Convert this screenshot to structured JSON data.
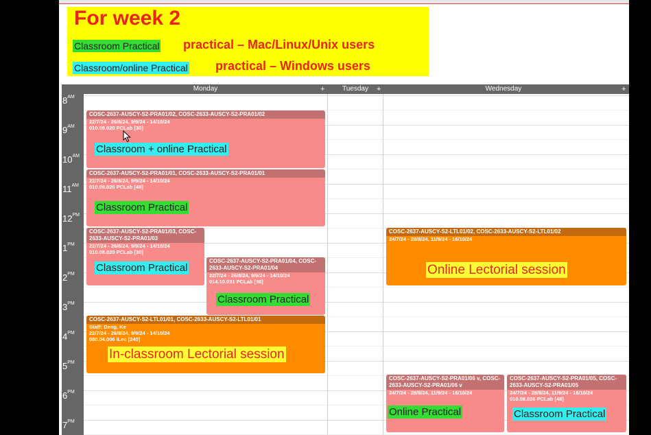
{
  "legend": {
    "title": "For week 2",
    "items": [
      {
        "swatch": "Classroom Practical",
        "desc": "practical – Mac/Linux/Unix users",
        "color": "#33dd33"
      },
      {
        "swatch": "Classroom/online Practical",
        "desc": "practical – Windows users",
        "color": "#33eeee"
      }
    ]
  },
  "calendar": {
    "days": [
      {
        "name": "Monday",
        "plus": "+"
      },
      {
        "name": "Tuesday",
        "plus": "+"
      },
      {
        "name": "Wednesday",
        "plus": "+"
      }
    ],
    "hours": [
      {
        "num": "8",
        "suf": "AM"
      },
      {
        "num": "9",
        "suf": "AM"
      },
      {
        "num": "10",
        "suf": "AM"
      },
      {
        "num": "11",
        "suf": "AM"
      },
      {
        "num": "12",
        "suf": "PM"
      },
      {
        "num": "1",
        "suf": "PM"
      },
      {
        "num": "2",
        "suf": "PM"
      },
      {
        "num": "3",
        "suf": "PM"
      },
      {
        "num": "4",
        "suf": "PM"
      },
      {
        "num": "5",
        "suf": "PM"
      },
      {
        "num": "6",
        "suf": "PM"
      },
      {
        "num": "7",
        "suf": "PM"
      }
    ],
    "events": [
      {
        "id": "ev1",
        "title": "COSC-2637-AUSCY-S2-PRA01/02, COSC-2633-AUSCY-S2-PRA01/02",
        "lines": [
          "22/7/24 - 26/8/24, 9/9/24 - 14/10/24",
          "010.08.020 PCLab [30]"
        ],
        "label": "Classroom + online Practical",
        "label_style": "cyan"
      },
      {
        "id": "ev2",
        "title": "COSC-2637-AUSCY-S2-PRA01/01, COSC-2633-AUSCY-S2-PRA01/01",
        "lines": [
          "22/7/24 - 26/8/24, 9/9/24 - 14/10/24",
          "010.08.026 PCLab [48]"
        ],
        "label": "Classroom Practical",
        "label_style": "green"
      },
      {
        "id": "ev3",
        "title": "COSC-2637-AUSCY-S2-PRA01/03, COSC-2633-AUSCY-S2-PRA01/03",
        "lines": [
          "22/7/24 - 26/8/24, 9/9/24 - 14/10/24",
          "010.08.020 PCLab [30]"
        ],
        "label": "Classroom Practical",
        "label_style": "cyan"
      },
      {
        "id": "ev4",
        "title": "COSC-2637-AUSCY-S2-PRA01/04, COSC-2633-AUSCY-S2-PRA01/04",
        "lines": [
          "22/7/24 - 26/8/24, 9/9/24 - 14/10/24",
          "014.10.031 PCLab [36]"
        ],
        "label": "Classroom Practical",
        "label_style": "green"
      },
      {
        "id": "ev5",
        "title": "COSC-2637-AUSCY-S2-LTL01/01, COSC-2633-AUSCY-S2-LTL01/01",
        "lines": [
          "Staff: Deng, Ke",
          "22/7/24 - 26/8/24, 9/9/24 - 14/10/24",
          "080.04.006 iLec [240]"
        ],
        "label": "In-classroom Lectorial session",
        "label_style": "yellow"
      },
      {
        "id": "ev6",
        "title": "COSC-2637-AUSCY-S2-LTL01/02, COSC-2633-AUSCY-S2-LTL01/02",
        "lines": [
          "24/7/24 - 28/8/24, 11/9/24 - 16/10/24"
        ],
        "label": "Online Lectorial session",
        "label_style": "yellow"
      },
      {
        "id": "ev7",
        "title": "COSC-2637-AUSCY-S2-PRA01/06 v, COSC-2633-AUSCY-S2-PRA01/06 v",
        "lines": [
          "24/7/24 - 28/8/24, 11/9/24 - 16/10/24"
        ],
        "label": "Online Practical",
        "label_style": "green"
      },
      {
        "id": "ev8",
        "title": "COSC-2637-AUSCY-S2-PRA01/05, COSC-2633-AUSCY-S2-PRA01/05",
        "lines": [
          "24/7/24 - 28/8/24, 11/9/24 - 16/10/24",
          "010.08.026 PCLab [48]"
        ],
        "label": "Classroom Practical",
        "label_style": "cyan"
      }
    ]
  }
}
